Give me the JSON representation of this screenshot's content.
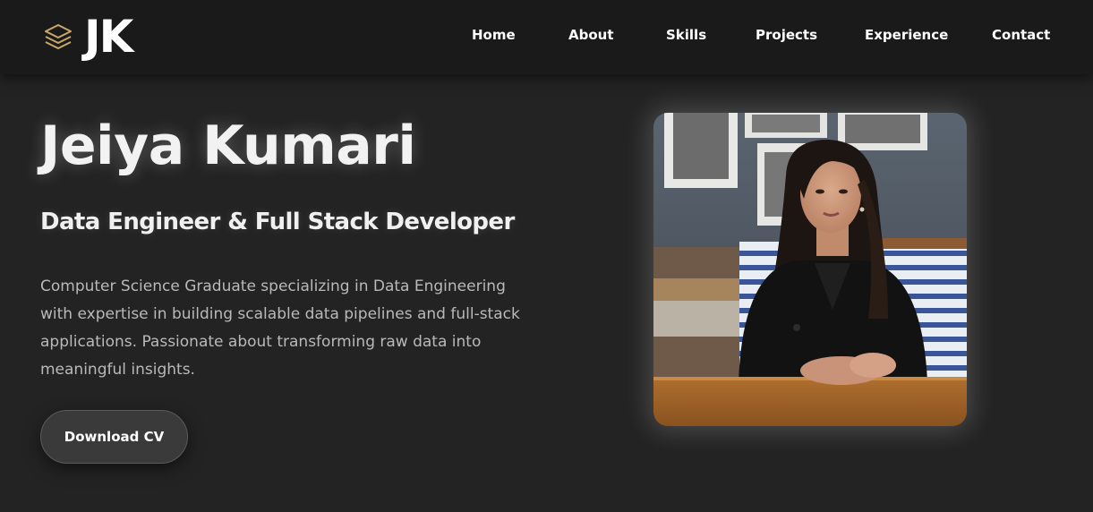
{
  "nav": {
    "logo_text": "JK",
    "logo_icon": "layers-icon",
    "links": [
      {
        "label": "Home"
      },
      {
        "label": "About"
      },
      {
        "label": "Skills"
      },
      {
        "label": "Projects"
      },
      {
        "label": "Experience"
      },
      {
        "label": "Contact"
      }
    ]
  },
  "hero": {
    "name": "Jeiya Kumari",
    "role": "Data Engineer & Full Stack Developer",
    "bio": "Computer Science Graduate specializing in Data Engineering with expertise in building scalable data pipelines and full-stack applications. Passionate about transforming raw data into meaningful insights.",
    "cv_button": "Download CV",
    "photo": "profile-photo"
  },
  "colors": {
    "background": "#232323",
    "navbar": "#1a1a1a",
    "accent_gold": "#c9a86a",
    "text_primary": "#f2f2f2",
    "text_secondary": "#b9b9b9"
  }
}
